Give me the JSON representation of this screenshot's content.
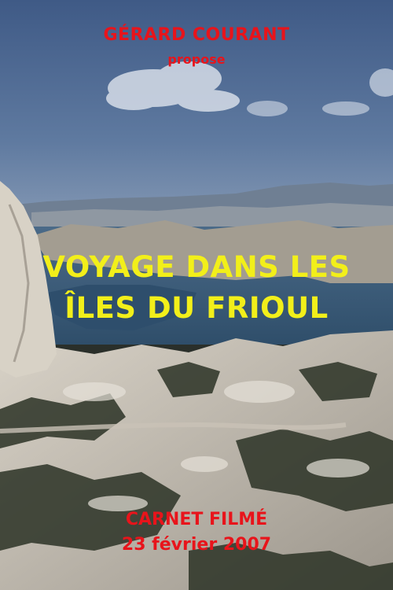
{
  "poster": {
    "director": "GÉRARD COURANT",
    "presents": "propose",
    "title_line1": "VOYAGE DANS LES",
    "title_line2": "ÎLES DU FRIOUL",
    "subtitle_line1": "CARNET FILMÉ",
    "subtitle_line2": "23 février 2007",
    "colors": {
      "credit_text": "#e8141b",
      "title_text": "#f2ef1a",
      "sky": "#3f5a86",
      "sea": "#3e5f7d",
      "rock": "#b8b2a6",
      "scrub": "#2c3326"
    }
  }
}
